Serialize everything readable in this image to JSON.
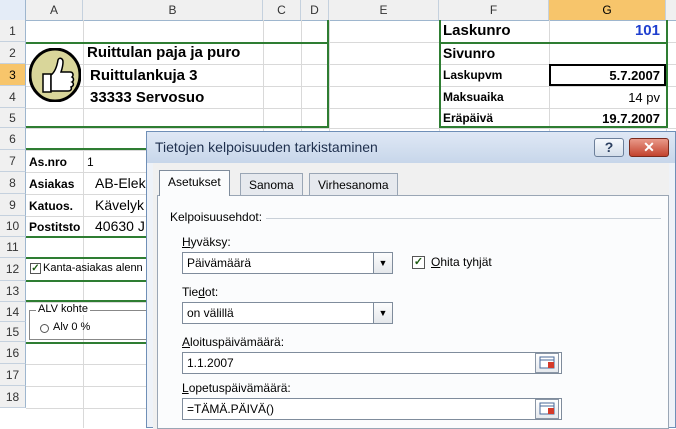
{
  "columns": [
    "A",
    "B",
    "C",
    "D",
    "E",
    "F",
    "G"
  ],
  "selected_column": "G",
  "rows": [
    "1",
    "2",
    "3",
    "4",
    "5",
    "6",
    "7",
    "8",
    "9",
    "10",
    "11",
    "12",
    "13",
    "14",
    "15",
    "16",
    "17",
    "18"
  ],
  "selected_row": "3",
  "company": {
    "name": "Ruittulan paja ja puro",
    "street": "Ruittulankuja 3",
    "postal": "33333 Servosuo"
  },
  "invoice": {
    "number_label": "Laskunro",
    "number_value": "101",
    "page_label": "Sivunro",
    "date_label": "Laskupvm",
    "date_value": "5.7.2007",
    "terms_label": "Maksuaika",
    "terms_value": "14 pv",
    "due_label": "Eräpäivä",
    "due_value": "19.7.2007"
  },
  "customer": {
    "asnro_label": "As.nro",
    "asnro_value": "1",
    "asiakas_label": "Asiakas",
    "asiakas_value": "AB-Elek",
    "katuos_label": "Katuos.",
    "katuos_value": "Kävelyk",
    "postitst_label": "Postitsto",
    "postitst_value": "40630 J"
  },
  "discount_checkbox": {
    "label": "Kanta-asiakas alenn",
    "checked": true
  },
  "vat_group": {
    "title": "ALV kohte",
    "option": "Alv 0 %"
  },
  "dialog": {
    "title": "Tietojen kelpoisuuden tarkistaminen",
    "help": "?",
    "close": "✕",
    "tabs": [
      "Asetukset",
      "Sanoma",
      "Virhesanoma"
    ],
    "active_tab": "Asetukset",
    "section": "Kelpoisuusehdot:",
    "allow_label_u": "H",
    "allow_label_rest": "yväksy:",
    "allow_value": "Päivämäärä",
    "ignore_blank_u": "O",
    "ignore_blank_rest": "hita tyhjät",
    "ignore_blank_checked": true,
    "data_label_u": "Tie",
    "data_label_d": "d",
    "data_label_rest": "ot:",
    "data_value": "on välillä",
    "start_label_u": "A",
    "start_label_rest": "loituspäivämäärä:",
    "start_value": "1.1.2007",
    "end_label_u": "L",
    "end_label_rest": "opetuspäivämäärä:",
    "end_value": "=TÄMÄ.PÄIVÄ()"
  },
  "colors": {
    "grid_border": "#2e7d32",
    "invoice_number": "#1f3fcf",
    "selected_header": "#f7c56b"
  }
}
